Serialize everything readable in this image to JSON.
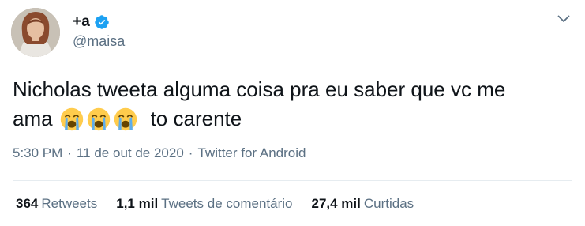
{
  "author": {
    "display_name": "+a",
    "handle": "@maisa",
    "verified": true,
    "accent_color": "#1da1f2"
  },
  "tweet": {
    "line1": "Nicholas tweeta alguma coisa pra eu saber que vc me",
    "line2_start": "ama",
    "emojis": [
      "loudly-crying-face",
      "loudly-crying-face",
      "loudly-crying-face"
    ],
    "line2_end": "to carente"
  },
  "meta": {
    "time": "5:30 PM",
    "date": "11 de out de 2020",
    "source": "Twitter for Android",
    "separator": "·"
  },
  "stats": [
    {
      "value": "364",
      "label": "Retweets"
    },
    {
      "value": "1,1 mil",
      "label": "Tweets de comentário"
    },
    {
      "value": "27,4 mil",
      "label": "Curtidas"
    }
  ],
  "icons": {
    "caret": "chevron-down-icon",
    "verified": "verified-badge-icon"
  }
}
